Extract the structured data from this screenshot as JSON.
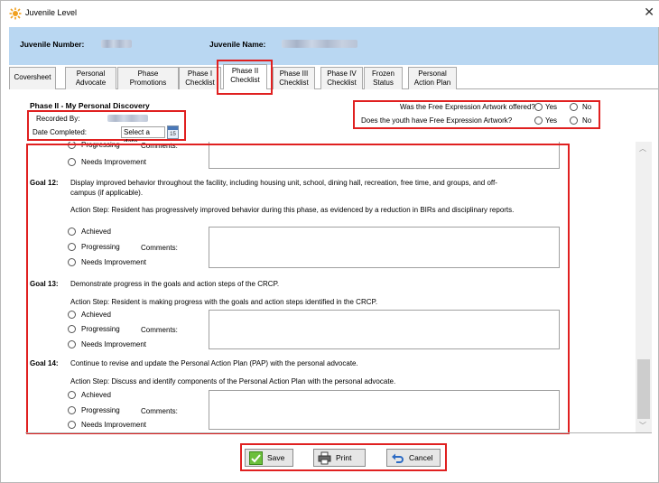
{
  "window": {
    "title": "Juvenile Level",
    "close_icon": "close-icon"
  },
  "header": {
    "number_label": "Juvenile Number:",
    "name_label": "Juvenile Name:",
    "background_color": "#b9d7f2"
  },
  "tabs": [
    {
      "l1": "Coversheet",
      "l2": ""
    },
    {
      "l1": "Personal",
      "l2": "Advocate"
    },
    {
      "l1": "Phase",
      "l2": "Promotions"
    },
    {
      "l1": "Phase I",
      "l2": "Checklist"
    },
    {
      "l1": "Phase II",
      "l2": "Checklist"
    },
    {
      "l1": "Phase III",
      "l2": "Checklist"
    },
    {
      "l1": "Phase IV",
      "l2": "Checklist"
    },
    {
      "l1": "Frozen",
      "l2": "Status"
    },
    {
      "l1": "Personal",
      "l2": "Action Plan"
    }
  ],
  "active_tab": "Phase II Checklist",
  "form": {
    "phase_title": "Phase II - My Personal Discovery",
    "recorded_by_label": "Recorded By:",
    "date_completed_label": "Date Completed:",
    "date_placeholder": "Select a date",
    "calendar_day": "15",
    "artwork_offered_q": "Was the Free Expression Artwork offered?",
    "artwork_have_q": "Does the youth have Free Expression Artwork?",
    "yes": "Yes",
    "no": "No"
  },
  "partial": {
    "progressing": "Progressing",
    "needs_improvement": "Needs Improvement",
    "comments": "Comments:"
  },
  "goals": [
    {
      "label": "Goal 12:",
      "text_line1": "Display improved behavior throughout the facility, including housing unit, school, dining hall, recreation, free time, and groups, and off-",
      "text_line2": "campus (if applicable).",
      "action": "Action Step: Resident has progressively improved behavior during this phase, as evidenced by a reduction in BIRs and disciplinary reports.",
      "options": [
        "Achieved",
        "Progressing",
        "Needs Improvement"
      ],
      "comments": "Comments:"
    },
    {
      "label": "Goal 13:",
      "text_line1": "Demonstrate progress in the goals and action steps of the CRCP.",
      "text_line2": "",
      "action": "Action Step: Resident is making progress with the goals and action steps identified in the CRCP.",
      "options": [
        "Achieved",
        "Progressing",
        "Needs Improvement"
      ],
      "comments": "Comments:"
    },
    {
      "label": "Goal 14:",
      "text_line1": "Continue to revise and update the Personal Action Plan (PAP) with the personal advocate.",
      "text_line2": "",
      "action": "Action Step: Discuss and identify components of the Personal Action Plan with the personal advocate.",
      "options": [
        "Achieved",
        "Progressing",
        "Needs Improvement"
      ],
      "comments": "Comments:"
    }
  ],
  "buttons": {
    "save": "Save",
    "print": "Print",
    "cancel": "Cancel"
  },
  "colors": {
    "highlight": "#e02020",
    "header": "#b9d7f2",
    "title_icon": "#f0a020"
  }
}
